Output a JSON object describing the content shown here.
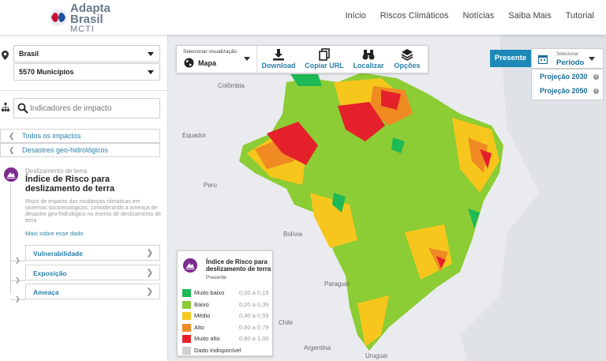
{
  "header": {
    "logo_line1": "Adapta",
    "logo_line2": "Brasil",
    "logo_line3": "MCTI",
    "nav": [
      "Início",
      "Riscos Climáticos",
      "Notícias",
      "Saiba Mais",
      "Tutorial"
    ]
  },
  "sidebar": {
    "location_select": "Brasil",
    "municipios_select": "5570 Municípios",
    "search_placeholder": "Indicadores de impacto",
    "breadcrumbs": [
      "Todos os impactos",
      "Desastres geo-hidrológicos"
    ],
    "indicator": {
      "kicker": "Deslizamento de terra",
      "title": "Índice de Risco para deslizamento de terra",
      "description": "Risco de impacto das mudanças climáticas em sistemas socioecológicos, considerando a ameaça de desastre geo-hidrológico no evento de deslizamento de terra",
      "more_link": "Mais sobre esse dado"
    },
    "subitems": [
      "Vulnerabilidade",
      "Exposição",
      "Ameaça"
    ]
  },
  "toolbar": {
    "viz_small": "Selecionar visualização",
    "viz_value": "Mapa",
    "tools": [
      "Download",
      "Copiar URL",
      "Localizar",
      "Opções"
    ],
    "globe_icon": "globe-icon",
    "download_icon": "download-icon",
    "copy_icon": "copy-icon",
    "localizar_icon": "binoculars-icon",
    "opcoes_icon": "layers-icon"
  },
  "period": {
    "presente_label": "Presente",
    "selector_small": "Selecionar",
    "selector_value": "Período",
    "options": [
      "Projeção 2030",
      "Projeção 2050"
    ],
    "info_glyph": "i"
  },
  "map": {
    "labels": [
      "Colômbia",
      "Equador",
      "Peru",
      "Bolívia",
      "Paraguai",
      "Chile",
      "Argentina",
      "Uruguai"
    ]
  },
  "legend": {
    "title": "Índice de Risco para deslizamento de terra",
    "subtitle": "Presente",
    "classes": [
      {
        "label": "Muito baixo",
        "range": "0,00 a 0,19",
        "color": "#1db954"
      },
      {
        "label": "Baixo",
        "range": "0,20 a 0,39",
        "color": "#8ccc34"
      },
      {
        "label": "Médio",
        "range": "0,40 a 0,59",
        "color": "#f7c61d"
      },
      {
        "label": "Alto",
        "range": "0,60 a 0,79",
        "color": "#f08a22"
      },
      {
        "label": "Muito alto",
        "range": "0,80 a 1,00",
        "color": "#e4212b"
      },
      {
        "label": "Dado indisponível",
        "range": "",
        "color": "#d0d0d0"
      }
    ]
  },
  "colors": {
    "accent": "#1e88b8",
    "link": "#2a7fa9",
    "indicator_purple": "#7b2d8e"
  }
}
